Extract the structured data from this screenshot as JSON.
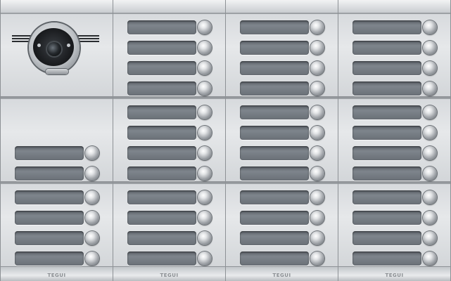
{
  "panel": {
    "brand": "TEGUI",
    "columns": [
      {
        "modules": [
          {
            "type": "camera",
            "buttons": 0
          },
          {
            "type": "buttons",
            "buttons": 2
          },
          {
            "type": "buttons",
            "buttons": 4
          }
        ]
      },
      {
        "modules": [
          {
            "type": "buttons",
            "buttons": 4
          },
          {
            "type": "buttons",
            "buttons": 4
          },
          {
            "type": "buttons",
            "buttons": 4
          }
        ]
      },
      {
        "modules": [
          {
            "type": "buttons",
            "buttons": 4
          },
          {
            "type": "buttons",
            "buttons": 4
          },
          {
            "type": "buttons",
            "buttons": 4
          }
        ]
      },
      {
        "modules": [
          {
            "type": "buttons",
            "buttons": 4
          },
          {
            "type": "buttons",
            "buttons": 4
          },
          {
            "type": "buttons",
            "buttons": 4
          }
        ]
      }
    ],
    "colors": {
      "label": "#6a7077",
      "frame": "#e4e6e8",
      "lens": "#1c1e21"
    }
  }
}
